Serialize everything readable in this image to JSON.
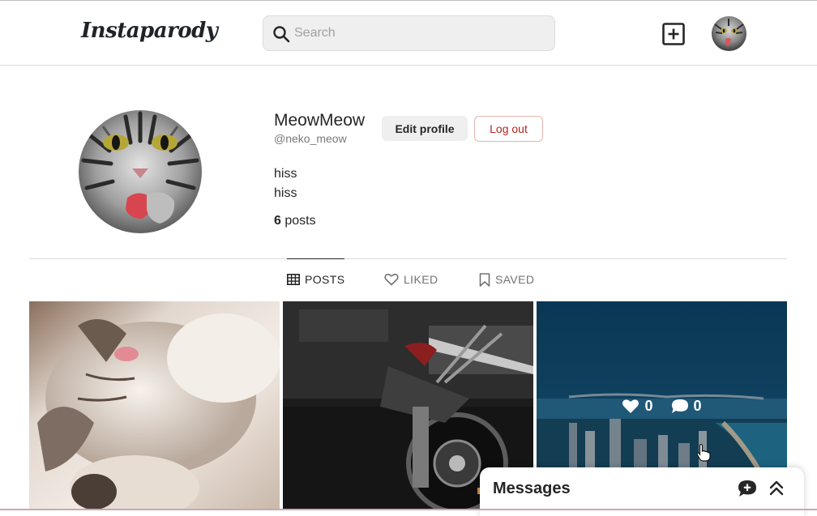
{
  "header": {
    "logo": "Instaparody",
    "search_placeholder": "Search",
    "icons": [
      "search-icon",
      "plus-square-icon"
    ]
  },
  "profile": {
    "display_name": "MeowMeow",
    "handle": "@neko_meow",
    "edit_label": "Edit profile",
    "logout_label": "Log out",
    "bio": [
      "hiss",
      "hiss"
    ],
    "posts_count": "6",
    "posts_label": "posts"
  },
  "tabs": [
    {
      "label": "POSTS",
      "icon": "grid-icon",
      "active": true
    },
    {
      "label": "LIKED",
      "icon": "heart-outline-icon",
      "active": false
    },
    {
      "label": "SAVED",
      "icon": "bookmark-icon",
      "active": false
    }
  ],
  "grid": [
    {
      "subject": "kitten-photo"
    },
    {
      "subject": "motorcycle-photo"
    },
    {
      "subject": "coastal-city-photo",
      "likes": "0",
      "comments": "0",
      "hovered": true
    }
  ],
  "messages": {
    "title": "Messages",
    "icons": [
      "new-message-icon",
      "chevrons-up-icon"
    ]
  },
  "colors": {
    "logout_text": "#b3261e",
    "logout_border": "#e8b4ad",
    "search_bg": "#efefef",
    "divider": "#dbdbdb"
  }
}
